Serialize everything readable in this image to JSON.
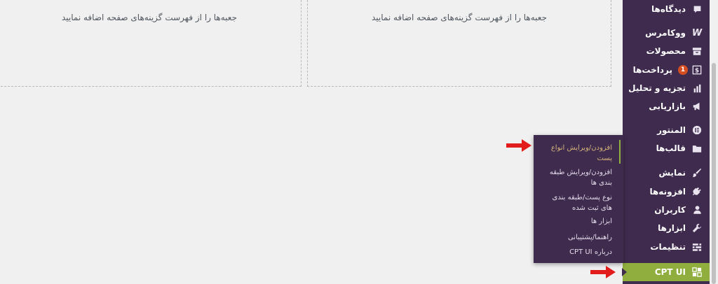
{
  "dashboard": {
    "left_box_message": "جعبه‌ها را از فهرست گزینه‌های صفحه اضافه نمایید",
    "right_box_message": "جعبه‌ها را از فهرست گزینه‌های صفحه اضافه نمایید"
  },
  "sidebar": {
    "items": [
      {
        "label": "دیدگاه‌ها",
        "icon": "comment-icon"
      },
      {
        "label": "ووکامرس",
        "icon": "woocommerce-icon"
      },
      {
        "label": "محصولات",
        "icon": "archive-icon"
      },
      {
        "label": "پرداخت‌ها",
        "icon": "dollar-icon",
        "badge": "1"
      },
      {
        "label": "تجزیه و تحلیل",
        "icon": "chart-bar-icon"
      },
      {
        "label": "بازاریابی",
        "icon": "megaphone-icon"
      },
      {
        "label": "المنتور",
        "icon": "elementor-icon"
      },
      {
        "label": "قالب‌ها",
        "icon": "folder-icon"
      },
      {
        "label": "نمایش",
        "icon": "brush-icon"
      },
      {
        "label": "افزونه‌ها",
        "icon": "plugin-icon"
      },
      {
        "label": "کاربران",
        "icon": "user-icon"
      },
      {
        "label": "ابزارها",
        "icon": "wrench-icon"
      },
      {
        "label": "تنظیمات",
        "icon": "settings-icon"
      },
      {
        "label": "CPT UI",
        "icon": "grid-icon"
      }
    ],
    "active_item": "CPT UI",
    "active_color": "#8fae3d",
    "background_color": "#3f2b4e"
  },
  "flyout": {
    "items": [
      {
        "line1": "افزودن/ویرایش انواع",
        "line2": "پست"
      },
      {
        "line1": "افزودن/ویرایش طبقه",
        "line2": "بندی ها"
      },
      {
        "line1": "نوع پست/طبقه بندی",
        "line2": "های ثبت شده"
      },
      {
        "line1": "ابزار ها",
        "line2": ""
      },
      {
        "line1": "راهنما/پشتیبانی",
        "line2": ""
      },
      {
        "line1": "درباره CPT UI",
        "line2": ""
      }
    ],
    "current_color": "#d6b47a"
  },
  "annotations": {
    "arrow_color": "#e21b1b"
  }
}
